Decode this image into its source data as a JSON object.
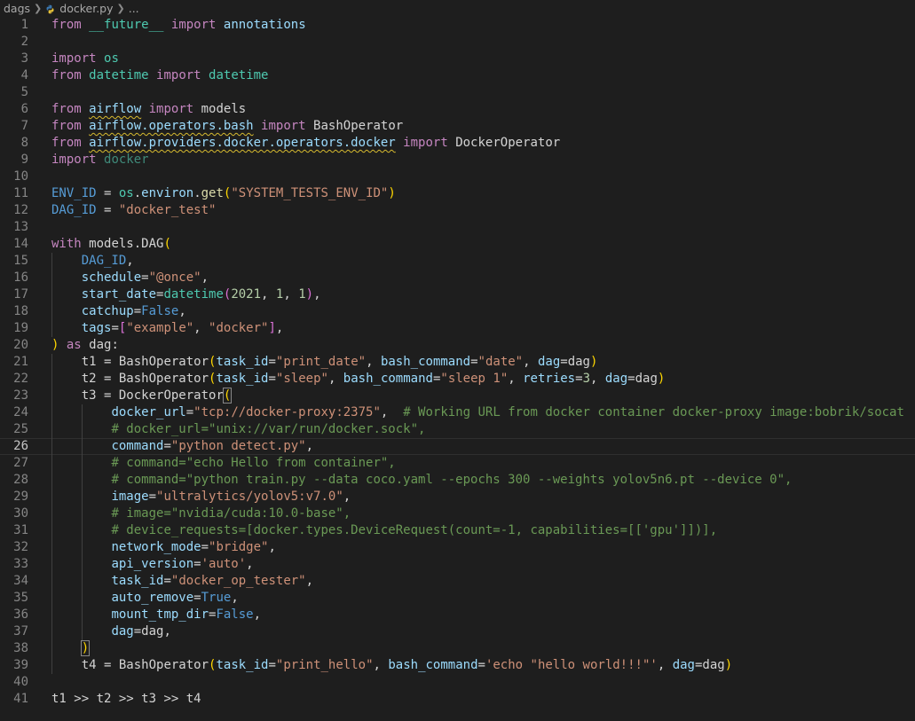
{
  "breadcrumb": {
    "folder": "dags",
    "file": "docker.py",
    "more": "..."
  },
  "editor": {
    "current_line": 26,
    "lines": [
      {
        "n": 1,
        "indent": 0,
        "tokens": [
          [
            "from",
            "kw"
          ],
          [
            " ",
            "p"
          ],
          [
            "__future__",
            "cls"
          ],
          [
            " ",
            "p"
          ],
          [
            "import",
            "kw"
          ],
          [
            " ",
            "p"
          ],
          [
            "annotations",
            "var"
          ]
        ]
      },
      {
        "n": 2,
        "indent": 0,
        "tokens": []
      },
      {
        "n": 3,
        "indent": 0,
        "tokens": [
          [
            "import",
            "kw"
          ],
          [
            " ",
            "p"
          ],
          [
            "os",
            "cls"
          ]
        ]
      },
      {
        "n": 4,
        "indent": 0,
        "tokens": [
          [
            "from",
            "kw"
          ],
          [
            " ",
            "p"
          ],
          [
            "datetime",
            "cls"
          ],
          [
            " ",
            "p"
          ],
          [
            "import",
            "kw"
          ],
          [
            " ",
            "p"
          ],
          [
            "datetime",
            "cls"
          ]
        ]
      },
      {
        "n": 5,
        "indent": 0,
        "tokens": []
      },
      {
        "n": 6,
        "indent": 0,
        "tokens": [
          [
            "from",
            "kw"
          ],
          [
            " ",
            "p"
          ],
          [
            "airflow",
            "squig"
          ],
          [
            " ",
            "p"
          ],
          [
            "import",
            "kw"
          ],
          [
            " ",
            "p"
          ],
          [
            "models",
            "p"
          ]
        ]
      },
      {
        "n": 7,
        "indent": 0,
        "tokens": [
          [
            "from",
            "kw"
          ],
          [
            " ",
            "p"
          ],
          [
            "airflow.operators.bash",
            "squig"
          ],
          [
            " ",
            "p"
          ],
          [
            "import",
            "kw"
          ],
          [
            " ",
            "p"
          ],
          [
            "BashOperator",
            "p"
          ]
        ]
      },
      {
        "n": 8,
        "indent": 0,
        "tokens": [
          [
            "from",
            "kw"
          ],
          [
            " ",
            "p"
          ],
          [
            "airflow.providers.docker.operators.docker",
            "squig"
          ],
          [
            " ",
            "p"
          ],
          [
            "import",
            "kw"
          ],
          [
            " ",
            "p"
          ],
          [
            "DockerOperator",
            "p"
          ]
        ]
      },
      {
        "n": 9,
        "indent": 0,
        "tokens": [
          [
            "import",
            "kw"
          ],
          [
            " ",
            "p"
          ],
          [
            "docker",
            "dim"
          ]
        ]
      },
      {
        "n": 10,
        "indent": 0,
        "tokens": []
      },
      {
        "n": 11,
        "indent": 0,
        "tokens": [
          [
            "ENV_ID",
            "const"
          ],
          [
            " = ",
            "p"
          ],
          [
            "os",
            "cls"
          ],
          [
            ".",
            "p"
          ],
          [
            "environ",
            "var"
          ],
          [
            ".",
            "p"
          ],
          [
            "get",
            "fn"
          ],
          [
            "(",
            "br1"
          ],
          [
            "\"SYSTEM_TESTS_ENV_ID\"",
            "str"
          ],
          [
            ")",
            "br1"
          ]
        ]
      },
      {
        "n": 12,
        "indent": 0,
        "tokens": [
          [
            "DAG_ID",
            "const"
          ],
          [
            " = ",
            "p"
          ],
          [
            "\"docker_test\"",
            "str"
          ]
        ]
      },
      {
        "n": 13,
        "indent": 0,
        "tokens": []
      },
      {
        "n": 14,
        "indent": 0,
        "tokens": [
          [
            "with",
            "kw"
          ],
          [
            " ",
            "p"
          ],
          [
            "models",
            "p"
          ],
          [
            ".",
            "p"
          ],
          [
            "DAG",
            "p"
          ],
          [
            "(",
            "br1"
          ]
        ]
      },
      {
        "n": 15,
        "indent": 1,
        "tokens": [
          [
            "    ",
            "p"
          ],
          [
            "DAG_ID",
            "const"
          ],
          [
            ",",
            "p"
          ]
        ]
      },
      {
        "n": 16,
        "indent": 1,
        "tokens": [
          [
            "    ",
            "p"
          ],
          [
            "schedule",
            "var"
          ],
          [
            "=",
            "p"
          ],
          [
            "\"@once\"",
            "str"
          ],
          [
            ",",
            "p"
          ]
        ]
      },
      {
        "n": 17,
        "indent": 1,
        "tokens": [
          [
            "    ",
            "p"
          ],
          [
            "start_date",
            "var"
          ],
          [
            "=",
            "p"
          ],
          [
            "datetime",
            "cls"
          ],
          [
            "(",
            "br2"
          ],
          [
            "2021",
            "num"
          ],
          [
            ", ",
            "p"
          ],
          [
            "1",
            "num"
          ],
          [
            ", ",
            "p"
          ],
          [
            "1",
            "num"
          ],
          [
            ")",
            "br2"
          ],
          [
            ",",
            "p"
          ]
        ]
      },
      {
        "n": 18,
        "indent": 1,
        "tokens": [
          [
            "    ",
            "p"
          ],
          [
            "catchup",
            "var"
          ],
          [
            "=",
            "p"
          ],
          [
            "False",
            "const"
          ],
          [
            ",",
            "p"
          ]
        ]
      },
      {
        "n": 19,
        "indent": 1,
        "tokens": [
          [
            "    ",
            "p"
          ],
          [
            "tags",
            "var"
          ],
          [
            "=",
            "p"
          ],
          [
            "[",
            "br2"
          ],
          [
            "\"example\"",
            "str"
          ],
          [
            ", ",
            "p"
          ],
          [
            "\"docker\"",
            "str"
          ],
          [
            "]",
            "br2"
          ],
          [
            ",",
            "p"
          ]
        ]
      },
      {
        "n": 20,
        "indent": 0,
        "tokens": [
          [
            ")",
            "br1"
          ],
          [
            " ",
            "p"
          ],
          [
            "as",
            "kw"
          ],
          [
            " ",
            "p"
          ],
          [
            "dag",
            "p"
          ],
          [
            ":",
            "p"
          ]
        ]
      },
      {
        "n": 21,
        "indent": 1,
        "tokens": [
          [
            "    ",
            "p"
          ],
          [
            "t1",
            "p"
          ],
          [
            " = ",
            "p"
          ],
          [
            "BashOperator",
            "p"
          ],
          [
            "(",
            "br1"
          ],
          [
            "task_id",
            "var"
          ],
          [
            "=",
            "p"
          ],
          [
            "\"print_date\"",
            "str"
          ],
          [
            ", ",
            "p"
          ],
          [
            "bash_command",
            "var"
          ],
          [
            "=",
            "p"
          ],
          [
            "\"date\"",
            "str"
          ],
          [
            ", ",
            "p"
          ],
          [
            "dag",
            "var"
          ],
          [
            "=",
            "p"
          ],
          [
            "dag",
            "p"
          ],
          [
            ")",
            "br1"
          ]
        ]
      },
      {
        "n": 22,
        "indent": 1,
        "tokens": [
          [
            "    ",
            "p"
          ],
          [
            "t2",
            "p"
          ],
          [
            " = ",
            "p"
          ],
          [
            "BashOperator",
            "p"
          ],
          [
            "(",
            "br1"
          ],
          [
            "task_id",
            "var"
          ],
          [
            "=",
            "p"
          ],
          [
            "\"sleep\"",
            "str"
          ],
          [
            ", ",
            "p"
          ],
          [
            "bash_command",
            "var"
          ],
          [
            "=",
            "p"
          ],
          [
            "\"sleep 1\"",
            "str"
          ],
          [
            ", ",
            "p"
          ],
          [
            "retries",
            "var"
          ],
          [
            "=",
            "p"
          ],
          [
            "3",
            "num"
          ],
          [
            ", ",
            "p"
          ],
          [
            "dag",
            "var"
          ],
          [
            "=",
            "p"
          ],
          [
            "dag",
            "p"
          ],
          [
            ")",
            "br1"
          ]
        ]
      },
      {
        "n": 23,
        "indent": 1,
        "tokens": [
          [
            "    ",
            "p"
          ],
          [
            "t3",
            "p"
          ],
          [
            " = ",
            "p"
          ],
          [
            "DockerOperator",
            "p"
          ],
          [
            "(",
            "match"
          ]
        ]
      },
      {
        "n": 24,
        "indent": 2,
        "tokens": [
          [
            "        ",
            "p"
          ],
          [
            "docker_url",
            "var"
          ],
          [
            "=",
            "p"
          ],
          [
            "\"tcp://docker-proxy:2375\"",
            "str"
          ],
          [
            ",  ",
            "p"
          ],
          [
            "# Working URL from docker container docker-proxy image:bobrik/socat",
            "cmt"
          ]
        ]
      },
      {
        "n": 25,
        "indent": 2,
        "tokens": [
          [
            "        ",
            "p"
          ],
          [
            "# docker_url=\"unix://var/run/docker.sock\",",
            "cmt"
          ]
        ]
      },
      {
        "n": 26,
        "indent": 2,
        "tokens": [
          [
            "        ",
            "p"
          ],
          [
            "command",
            "var"
          ],
          [
            "=",
            "p"
          ],
          [
            "\"python detect.py\"",
            "str"
          ],
          [
            ",",
            "p"
          ]
        ]
      },
      {
        "n": 27,
        "indent": 2,
        "tokens": [
          [
            "        ",
            "p"
          ],
          [
            "# command=\"echo Hello from container\",",
            "cmt"
          ]
        ]
      },
      {
        "n": 28,
        "indent": 2,
        "tokens": [
          [
            "        ",
            "p"
          ],
          [
            "# command=\"python train.py --data coco.yaml --epochs 300 --weights yolov5n6.pt --device 0\",",
            "cmt"
          ]
        ]
      },
      {
        "n": 29,
        "indent": 2,
        "tokens": [
          [
            "        ",
            "p"
          ],
          [
            "image",
            "var"
          ],
          [
            "=",
            "p"
          ],
          [
            "\"ultralytics/yolov5:v7.0\"",
            "str"
          ],
          [
            ",",
            "p"
          ]
        ]
      },
      {
        "n": 30,
        "indent": 2,
        "tokens": [
          [
            "        ",
            "p"
          ],
          [
            "# image=\"nvidia/cuda:10.0-base\",",
            "cmt"
          ]
        ]
      },
      {
        "n": 31,
        "indent": 2,
        "tokens": [
          [
            "        ",
            "p"
          ],
          [
            "# device_requests=[docker.types.DeviceRequest(count=-1, capabilities=[['gpu']])],",
            "cmt"
          ]
        ]
      },
      {
        "n": 32,
        "indent": 2,
        "tokens": [
          [
            "        ",
            "p"
          ],
          [
            "network_mode",
            "var"
          ],
          [
            "=",
            "p"
          ],
          [
            "\"bridge\"",
            "str"
          ],
          [
            ",",
            "p"
          ]
        ]
      },
      {
        "n": 33,
        "indent": 2,
        "tokens": [
          [
            "        ",
            "p"
          ],
          [
            "api_version",
            "var"
          ],
          [
            "=",
            "p"
          ],
          [
            "'auto'",
            "str"
          ],
          [
            ",",
            "p"
          ]
        ]
      },
      {
        "n": 34,
        "indent": 2,
        "tokens": [
          [
            "        ",
            "p"
          ],
          [
            "task_id",
            "var"
          ],
          [
            "=",
            "p"
          ],
          [
            "\"docker_op_tester\"",
            "str"
          ],
          [
            ",",
            "p"
          ]
        ]
      },
      {
        "n": 35,
        "indent": 2,
        "tokens": [
          [
            "        ",
            "p"
          ],
          [
            "auto_remove",
            "var"
          ],
          [
            "=",
            "p"
          ],
          [
            "True",
            "const"
          ],
          [
            ",",
            "p"
          ]
        ]
      },
      {
        "n": 36,
        "indent": 2,
        "tokens": [
          [
            "        ",
            "p"
          ],
          [
            "mount_tmp_dir",
            "var"
          ],
          [
            "=",
            "p"
          ],
          [
            "False",
            "const"
          ],
          [
            ",",
            "p"
          ]
        ]
      },
      {
        "n": 37,
        "indent": 2,
        "tokens": [
          [
            "        ",
            "p"
          ],
          [
            "dag",
            "var"
          ],
          [
            "=",
            "p"
          ],
          [
            "dag",
            "p"
          ],
          [
            ",",
            "p"
          ]
        ]
      },
      {
        "n": 38,
        "indent": 1,
        "tokens": [
          [
            "    ",
            "p"
          ],
          [
            ")",
            "match"
          ]
        ]
      },
      {
        "n": 39,
        "indent": 1,
        "tokens": [
          [
            "    ",
            "p"
          ],
          [
            "t4",
            "p"
          ],
          [
            " = ",
            "p"
          ],
          [
            "BashOperator",
            "p"
          ],
          [
            "(",
            "br1"
          ],
          [
            "task_id",
            "var"
          ],
          [
            "=",
            "p"
          ],
          [
            "\"print_hello\"",
            "str"
          ],
          [
            ", ",
            "p"
          ],
          [
            "bash_command",
            "var"
          ],
          [
            "=",
            "p"
          ],
          [
            "'echo \"hello world!!!\"'",
            "str"
          ],
          [
            ", ",
            "p"
          ],
          [
            "dag",
            "var"
          ],
          [
            "=",
            "p"
          ],
          [
            "dag",
            "p"
          ],
          [
            ")",
            "br1"
          ]
        ]
      },
      {
        "n": 40,
        "indent": 0,
        "tokens": []
      },
      {
        "n": 41,
        "indent": 0,
        "tokens": [
          [
            "t1",
            "p"
          ],
          [
            " >> ",
            "p"
          ],
          [
            "t2",
            "p"
          ],
          [
            " >> ",
            "p"
          ],
          [
            "t3",
            "p"
          ],
          [
            " >> ",
            "p"
          ],
          [
            "t4",
            "p"
          ]
        ]
      }
    ]
  }
}
